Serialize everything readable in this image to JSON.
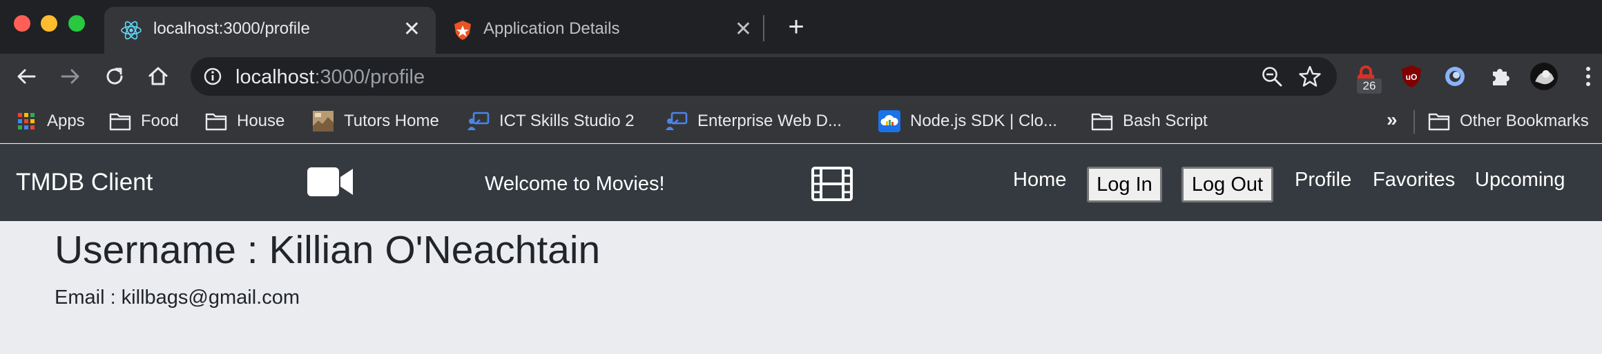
{
  "browser": {
    "tabs": [
      {
        "title": "localhost:3000/profile",
        "active": true,
        "icon": "react-icon"
      },
      {
        "title": "Application Details",
        "active": false,
        "icon": "auth0-icon"
      }
    ],
    "address": {
      "host": "localhost",
      "path": ":3000/profile"
    },
    "extension_badge": "26",
    "bookmarks": [
      {
        "label": "Apps",
        "icon": "apps-grid-icon"
      },
      {
        "label": "Food",
        "icon": "folder-icon"
      },
      {
        "label": "House",
        "icon": "folder-icon"
      },
      {
        "label": "Tutors Home",
        "icon": "tutors-favicon"
      },
      {
        "label": "ICT Skills Studio 2",
        "icon": "classroom-icon"
      },
      {
        "label": "Enterprise Web D...",
        "icon": "classroom-icon"
      },
      {
        "label": "Node.js SDK | Clo...",
        "icon": "cloud-icon"
      },
      {
        "label": "Bash Script",
        "icon": "folder-icon"
      }
    ],
    "other_bookmarks": "Other Bookmarks",
    "overflow": "»"
  },
  "navbar": {
    "brand": "TMDB Client",
    "welcome": "Welcome to Movies!",
    "links": {
      "home": "Home",
      "login": "Log In",
      "logout": "Log Out",
      "profile": "Profile",
      "favorites": "Favorites",
      "upcoming": "Upcoming"
    }
  },
  "profile": {
    "username": "Username : Killian O'Neachtain",
    "email": "Email : killbags@gmail.com"
  },
  "colors": {
    "navbar_bg": "#343a40",
    "page_bg": "#ebecf0",
    "chrome_dark": "#202124",
    "chrome_toolbar": "#35363a"
  }
}
